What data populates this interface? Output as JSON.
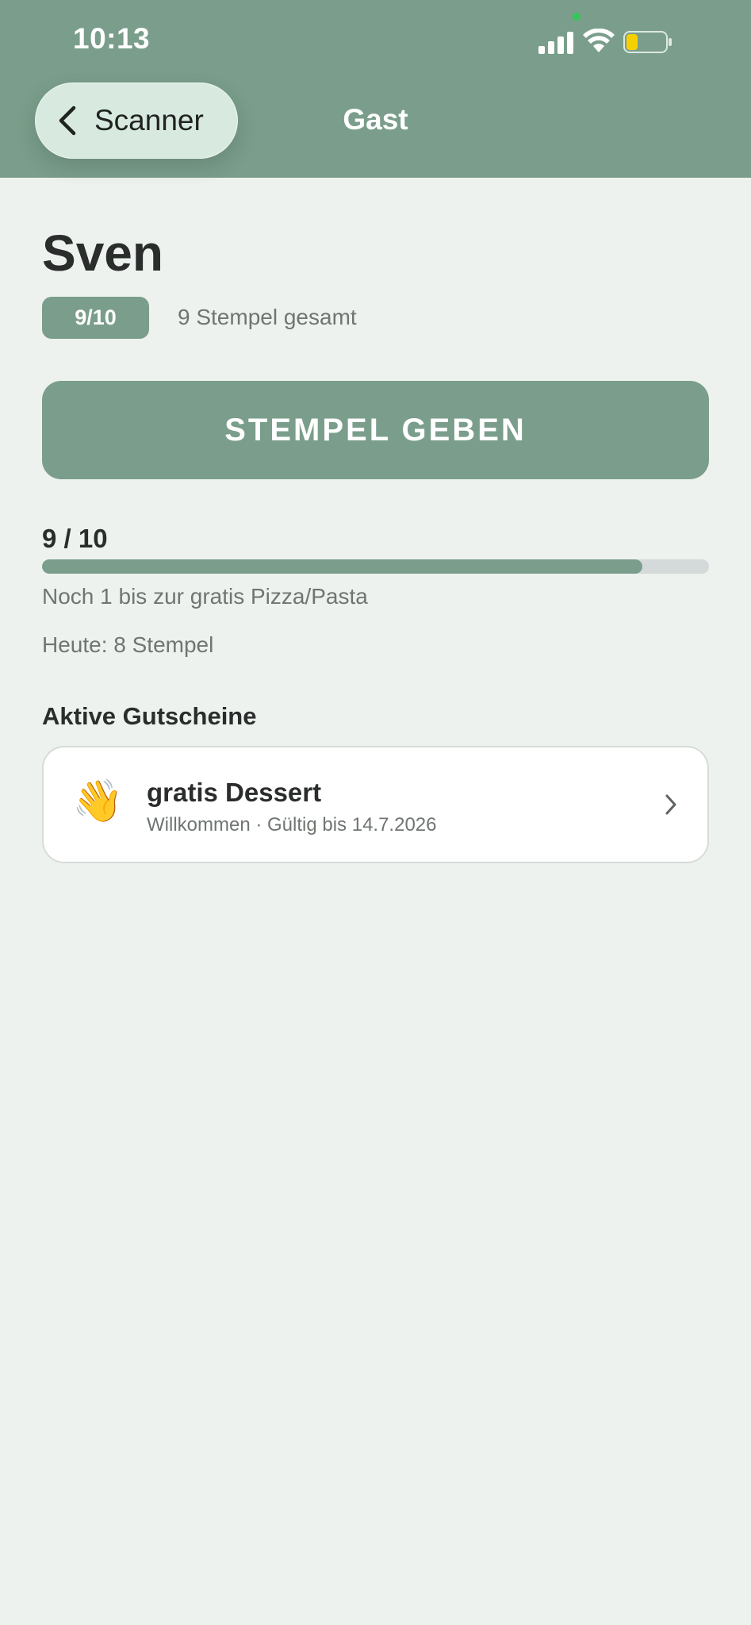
{
  "status_bar": {
    "time": "10:13",
    "icons": [
      "signal-icon",
      "wifi-icon",
      "battery-icon"
    ]
  },
  "nav": {
    "back_label": "Scanner",
    "title": "Gast"
  },
  "guest": {
    "name": "Sven",
    "badge": "9/10",
    "total_stamps": "9 Stempel gesamt"
  },
  "actions": {
    "give_stamp_label": "STEMPEL GEBEN"
  },
  "progress": {
    "label": "9 / 10",
    "current": 9,
    "goal": 10,
    "note": "Noch 1 bis zur gratis Pizza/Pasta",
    "today": "Heute: 8 Stempel"
  },
  "vouchers": {
    "section_title": "Aktive Gutscheine",
    "items": [
      {
        "icon": "👋",
        "icon_name": "waving-hand-icon",
        "title": "gratis Dessert",
        "meta": "Willkommen · Gültig bis 14.7.2026"
      }
    ]
  },
  "colors": {
    "accent": "#7a9e8b",
    "background": "#edf2ee",
    "back_button": "#d8e9df",
    "track": "#d4d9d9",
    "battery_level": "#f5d000"
  }
}
